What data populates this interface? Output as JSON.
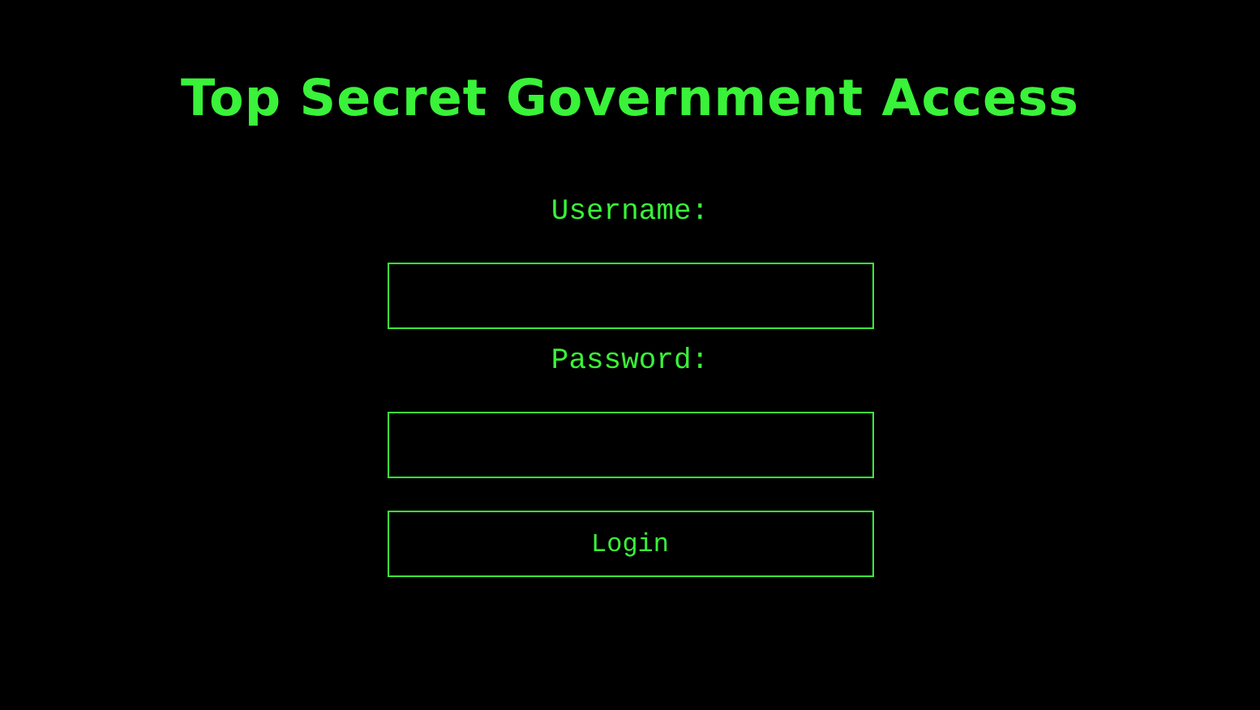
{
  "title": "Top Secret Government Access",
  "fields": [
    {
      "label": "Username:"
    },
    {
      "label": "Password:"
    }
  ],
  "button": {
    "label": "Login"
  }
}
